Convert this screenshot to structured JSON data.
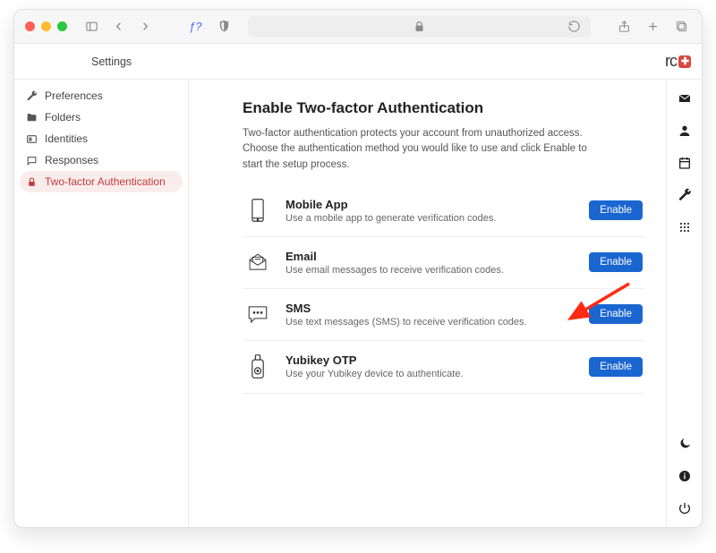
{
  "header": {
    "title": "Settings"
  },
  "sidebar": {
    "items": [
      {
        "label": "Preferences"
      },
      {
        "label": "Folders"
      },
      {
        "label": "Identities"
      },
      {
        "label": "Responses"
      },
      {
        "label": "Two-factor Authentication"
      }
    ]
  },
  "main": {
    "heading": "Enable Two-factor Authentication",
    "description": "Two-factor authentication protects your account from unauthorized access. Choose the authentication method you would like to use and click Enable to start the setup process.",
    "methods": [
      {
        "title": "Mobile App",
        "desc": "Use a mobile app to generate verification codes.",
        "button": "Enable"
      },
      {
        "title": "Email",
        "desc": "Use email messages to receive verification codes.",
        "button": "Enable"
      },
      {
        "title": "SMS",
        "desc": "Use text messages (SMS) to receive verification codes.",
        "button": "Enable"
      },
      {
        "title": "Yubikey OTP",
        "desc": "Use your Yubikey device to authenticate.",
        "button": "Enable"
      }
    ]
  },
  "logo": {
    "text": "rc"
  },
  "colors": {
    "accent": "#1a66d1",
    "active_bg": "#fbecec",
    "active_fg": "#c23b3b"
  }
}
